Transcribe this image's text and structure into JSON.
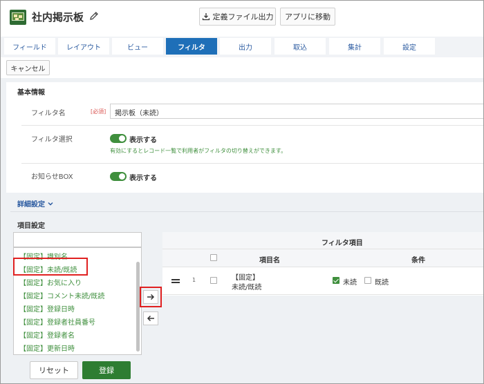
{
  "header": {
    "app_title": "社内掲示板",
    "export_button": "定義ファイル出力",
    "goto_app_button": "アプリに移動"
  },
  "tabs": [
    {
      "label": "フィールド",
      "active": false
    },
    {
      "label": "レイアウト",
      "active": false
    },
    {
      "label": "ビュー",
      "active": false
    },
    {
      "label": "フィルタ",
      "active": true
    },
    {
      "label": "出力",
      "active": false
    },
    {
      "label": "取込",
      "active": false
    },
    {
      "label": "集計",
      "active": false
    },
    {
      "label": "設定",
      "active": false
    }
  ],
  "cancel_button": "キャンセル",
  "basic_info": {
    "section_title": "基本情報",
    "filter_name_label": "フィルタ名",
    "required_badge": "[必須]",
    "filter_name_value": "掲示板（未読）",
    "filter_select_label": "フィルタ選択",
    "filter_select_toggle": "表示する",
    "filter_select_help": "有効にするとレコード一覧で利用者がフィルタの切り替えができます。",
    "notice_box_label": "お知らせBOX",
    "notice_box_toggle": "表示する"
  },
  "detail_settings_link": "詳細設定",
  "item_settings": {
    "section_title": "項目設定",
    "field_list": [
      "【固定】識別名",
      "【固定】未読/既読",
      "【固定】お気に入り",
      "【固定】コメント未読/既読",
      "【固定】登録日時",
      "【固定】登録者社員番号",
      "【固定】登録者名",
      "【固定】更新日時"
    ]
  },
  "filter_table": {
    "title": "フィルタ項目",
    "col_item_name": "項目名",
    "col_condition": "条件",
    "rows": [
      {
        "index": "1",
        "item_line1": "【固定】",
        "item_line2": "未読/既読",
        "opt_unread": "未読",
        "opt_read": "既読"
      }
    ]
  },
  "footer": {
    "reset_button": "リセット",
    "register_button": "登録"
  },
  "colors": {
    "accent_blue": "#1e6fb8",
    "green": "#3f8f3d",
    "highlight_red": "#e02020"
  }
}
